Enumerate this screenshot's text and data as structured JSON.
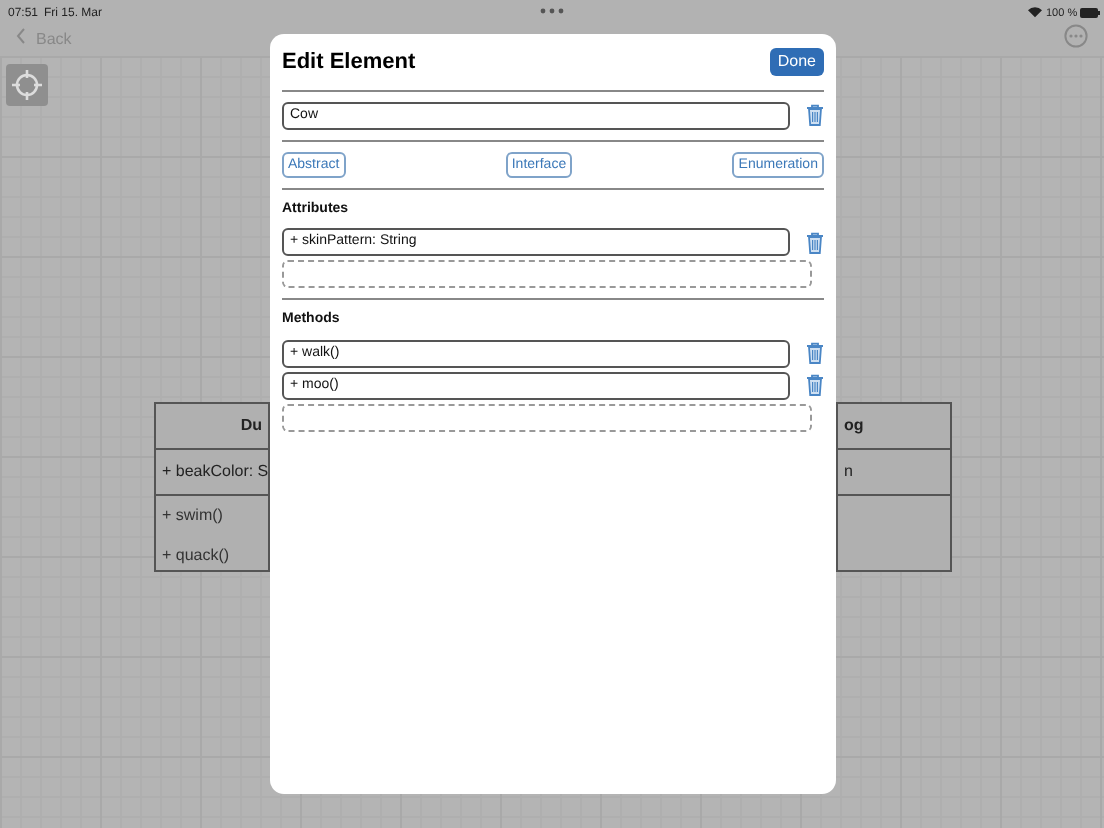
{
  "status_bar": {
    "time": "07:51",
    "date": "Fri 15. Mar",
    "battery": "100 %"
  },
  "nav": {
    "back": "Back"
  },
  "canvas": {
    "classes": [
      {
        "title": "Du",
        "attributes": [
          "+ beakColor: S"
        ],
        "methods": [
          "+ swim()",
          "+ quack()"
        ]
      },
      {
        "title": "og",
        "attributes": [
          "n"
        ]
      }
    ]
  },
  "dialog": {
    "title": "Edit Element",
    "done": "Done",
    "name": "Cow",
    "types": [
      "Abstract",
      "Interface",
      "Enumeration"
    ],
    "sections": [
      {
        "title": "Attributes",
        "items": [
          "+ skinPattern: String"
        ]
      },
      {
        "title": "Methods",
        "items": [
          "+ walk()",
          "+ moo()"
        ]
      }
    ]
  }
}
